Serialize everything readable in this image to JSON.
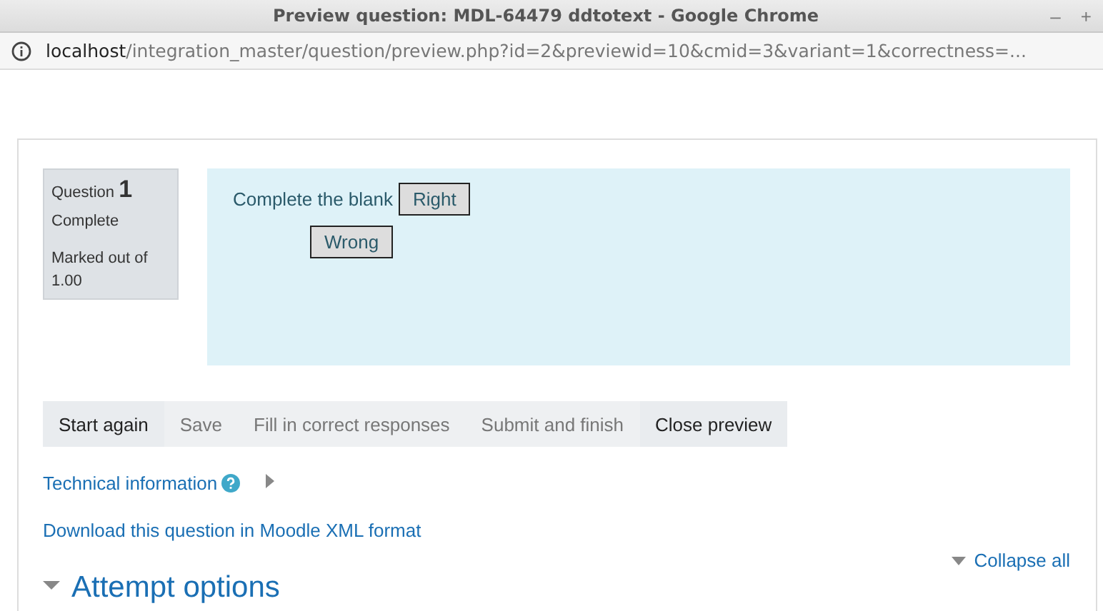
{
  "window": {
    "title": "Preview question: MDL-64479 ddtotext - Google Chrome",
    "controls": [
      "–",
      "+"
    ]
  },
  "address_bar": {
    "host": "localhost",
    "path": "/integration_master/question/preview.php?id=2&previewid=10&cmid=3&variant=1&correctness=..."
  },
  "question_info": {
    "label": "Question",
    "number": "1",
    "state": "Complete",
    "mark": "Marked out of 1.00"
  },
  "question": {
    "text": "Complete the blank",
    "placed": "Right",
    "choices": [
      "Wrong"
    ]
  },
  "buttons": [
    {
      "label": "Start again",
      "disabled": false
    },
    {
      "label": "Save",
      "disabled": true
    },
    {
      "label": "Fill in correct responses",
      "disabled": true
    },
    {
      "label": "Submit and finish",
      "disabled": true
    },
    {
      "label": "Close preview",
      "disabled": false
    }
  ],
  "technical_information": {
    "label": "Technical information",
    "expanded": false
  },
  "download_link": "Download this question in Moodle XML format",
  "collapse_all": "Collapse all",
  "section": {
    "title": "Attempt options",
    "expanded": true
  }
}
